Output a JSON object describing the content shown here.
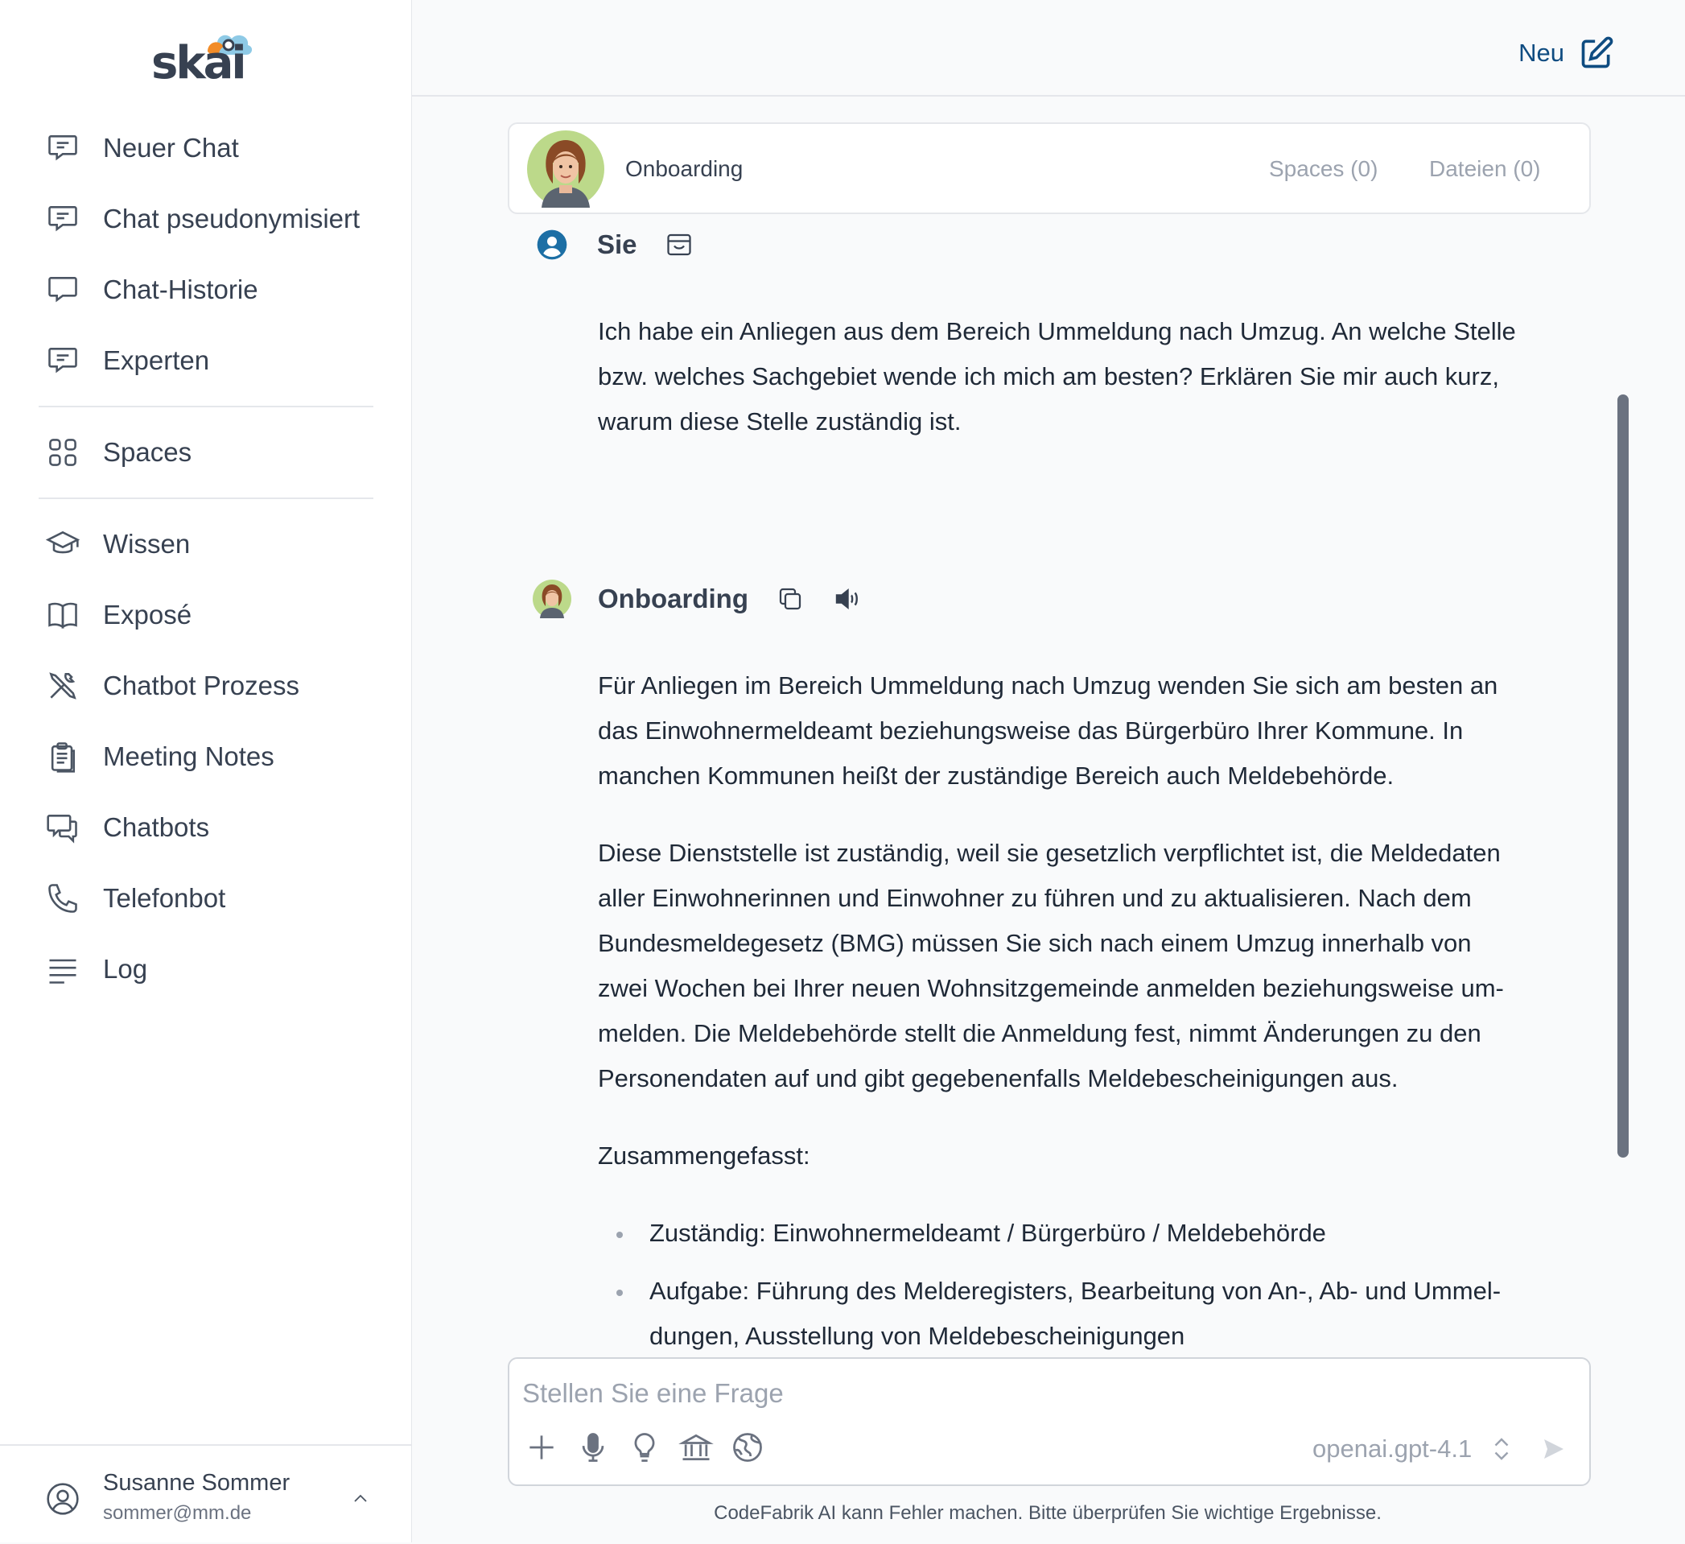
{
  "sidebar": {
    "logo": "skai",
    "items": [
      {
        "label": "Neuer Chat",
        "icon": "chat-bubble-lines-icon"
      },
      {
        "label": "Chat pseudonymisiert",
        "icon": "chat-bubble-lines-icon"
      },
      {
        "label": "Chat-Historie",
        "icon": "chat-bubble-icon"
      },
      {
        "label": "Experten",
        "icon": "chat-bubble-lines-icon"
      },
      {
        "label": "Spaces",
        "icon": "grid-icon"
      },
      {
        "label": "Wissen",
        "icon": "graduation-cap-icon"
      },
      {
        "label": "Exposé",
        "icon": "book-open-icon"
      },
      {
        "label": "Chatbot Prozess",
        "icon": "wrench-screwdriver-icon"
      },
      {
        "label": "Meeting Notes",
        "icon": "clipboard-icon"
      },
      {
        "label": "Chatbots",
        "icon": "chat-bubbles-icon"
      },
      {
        "label": "Telefonbot",
        "icon": "phone-icon"
      },
      {
        "label": "Log",
        "icon": "menu-lines-icon"
      }
    ],
    "user": {
      "name": "Susanne Sommer",
      "email": "sommer@mm.de"
    }
  },
  "header": {
    "new_label": "Neu"
  },
  "assistant": {
    "name": "Onboarding",
    "spaces_label": "Spaces (0)",
    "files_label": "Dateien (0)"
  },
  "messages": {
    "user": {
      "author": "Sie",
      "lines": [
        "Ich habe ein Anliegen aus dem Bereich Ummeldung nach Umzug. An welche Stelle",
        "bzw. welches Sachgebiet wende ich mich am besten? Erklären Sie mir auch kurz,",
        "warum diese Stelle zuständig ist."
      ]
    },
    "bot": {
      "author": "Onboarding",
      "para1": [
        "Für Anliegen im Bereich Ummeldung nach Umzug wenden Sie sich am besten an",
        "das Einwohnermeldeamt beziehungsweise das Bürgerbüro Ihrer Kommune. In",
        "manchen Kommunen heißt der zuständige Bereich auch Meldebehörde."
      ],
      "para2": [
        "Diese Dienststelle ist zuständig, weil sie gesetzlich verpflichtet ist, die Meldedaten",
        "aller Einwohnerinnen und Einwohner zu führen und zu aktualisieren. Nach dem",
        "Bundesmeldegesetz (BMG) müssen Sie sich nach einem Umzug innerhalb von",
        "zwei Wochen bei Ihrer neuen Wohnsitzgemeinde anmelden beziehungsweise um-",
        "melden. Die Meldebehörde stellt die Anmeldung fest, nimmt Änderungen zu den",
        "Personendaten auf und gibt gegebenenfalls Meldebescheinigungen aus."
      ],
      "summary_label": "Zusammengefasst:",
      "bullet1": "Zuständig: Einwohnermeldeamt / Bürgerbüro / Meldebehörde",
      "bullet2_lines": [
        "Aufgabe: Führung des Melderegisters, Bearbeitung von An-, Ab- und Ummel-",
        "dungen, Ausstellung von Meldebescheinigungen"
      ]
    }
  },
  "input": {
    "placeholder": "Stellen Sie eine Frage",
    "model": "openai.gpt-4.1"
  },
  "footer_note": "CodeFabrik AI kann Fehler machen. Bitte überprüfen Sie wichtige Ergebnisse.",
  "colors": {
    "accent": "#0f4c81",
    "user_icon": "#1d6fa5",
    "logo_orange": "#f28c28",
    "logo_cloud": "#8ecae6"
  }
}
